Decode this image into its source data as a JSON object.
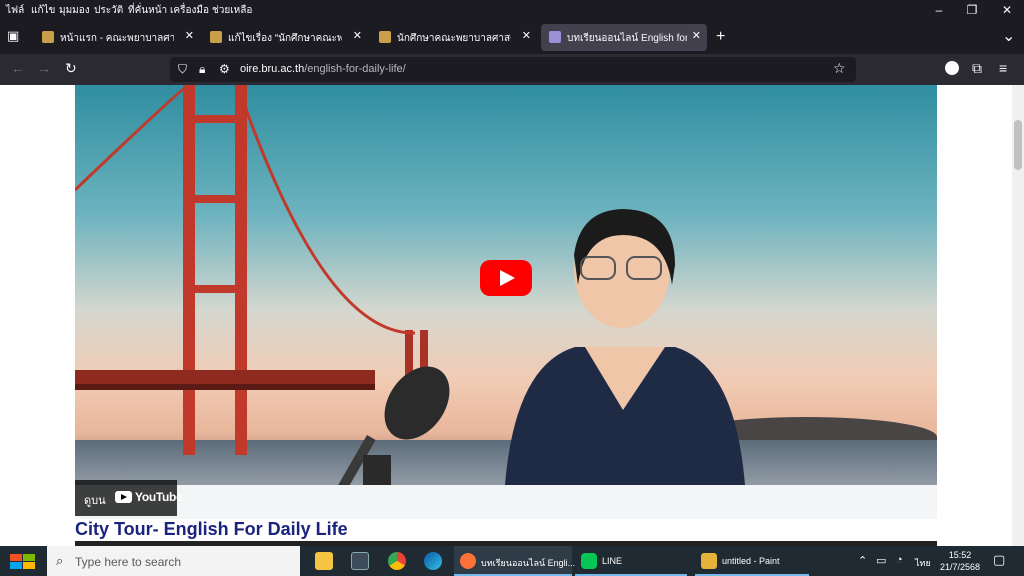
{
  "menu": {
    "items": [
      {
        "label": "ไฟล์"
      },
      {
        "label": "แก้ไข"
      },
      {
        "label": "มุมมอง"
      },
      {
        "label": "ประวัติ"
      },
      {
        "label": "ที่คั่นหน้า"
      },
      {
        "label": "เครื่องมือ"
      },
      {
        "label": "ช่วยเหลือ"
      }
    ]
  },
  "window_controls": {
    "minimize": "–",
    "restore": "❐",
    "close": "✕"
  },
  "tabs": [
    {
      "title": "หน้าแรก - คณะพยาบาลศาสตร์",
      "active": false
    },
    {
      "title": "แก้ไขเรื่อง “นักศึกษาคณะพยาบาล",
      "active": false
    },
    {
      "title": "นักศึกษาคณะพยาบาลศาสตร์ สาม",
      "active": false
    },
    {
      "title": "บทเรียนออนไลน์ English for Daily",
      "active": true
    }
  ],
  "tab_close_glyph": "✕",
  "new_tab_glyph": "+",
  "tab_list_glyph": "⌄",
  "nav": {
    "back": "←",
    "forward": "→",
    "reload": "↻",
    "url_domain": "oire.bru.ac.th",
    "url_path": "/english-for-daily-life/",
    "url_prefix": "",
    "star": "☆",
    "menu": "≡",
    "extensions": "⧉"
  },
  "video": {
    "watch_on_label": "ดูบน",
    "youtube_word": "YouTube"
  },
  "post": {
    "title": "City Tour- English For Daily Life"
  },
  "taskbar": {
    "search_placeholder": "Type here to search",
    "apps": [
      {
        "label": "บทเรียนออนไลน์ Engli...",
        "color": "#ff7139"
      },
      {
        "label": "LINE",
        "color": "#06c755"
      },
      {
        "label": "untitled - Paint",
        "color": "#e6b23a"
      }
    ],
    "lang": "ไทย",
    "time": "15:52",
    "date": "21/7/2568"
  },
  "colors": {
    "accent": "#ff0000",
    "post_title": "#1a237e",
    "taskbar": "#1f2a33"
  }
}
